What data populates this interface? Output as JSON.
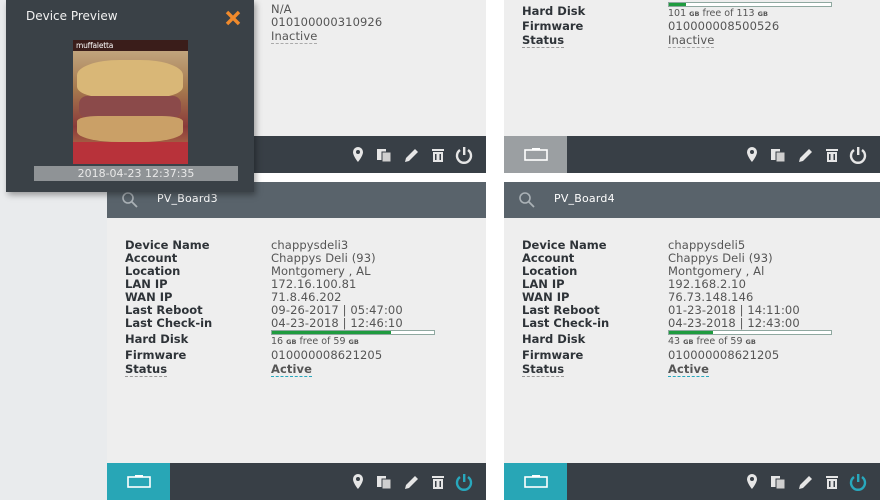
{
  "preview": {
    "title": "Device Preview",
    "image_brand": "muffaletta",
    "timestamp": "2018-04-23 12:37:35"
  },
  "labels": {
    "device_name": "Device Name",
    "account": "Account",
    "location": "Location",
    "lan_ip": "LAN IP",
    "wan_ip": "WAN IP",
    "last_reboot": "Last Reboot",
    "last_checkin": "Last Check-in",
    "hard_disk": "Hard Disk",
    "firmware": "Firmware",
    "status": "Status"
  },
  "disk_unit": "GB",
  "cards": {
    "top_left": {
      "rows_visible": {
        "line1": "N/A",
        "firmware": "010100000310926",
        "status": "Inactive"
      }
    },
    "top_right": {
      "hard_disk": {
        "free": "101",
        "total": "113",
        "used_fraction": 0.11
      },
      "firmware": "010000008500526",
      "status": "Inactive"
    },
    "board3": {
      "board": "PV_Board3",
      "device_name": "chappysdeli3",
      "account": "Chappys Deli (93)",
      "location": "Montgomery , AL",
      "lan_ip": "172.16.100.81",
      "wan_ip": "71.8.46.202",
      "last_reboot": "09-26-2017 | 05:47:00",
      "last_checkin": "04-23-2018 | 12:46:10",
      "hard_disk": {
        "free": "16",
        "total": "59",
        "used_fraction": 0.73
      },
      "firmware": "010000008621205",
      "status": "Active"
    },
    "board4": {
      "board": "PV_Board4",
      "device_name": "chappysdeli5",
      "account": "Chappys Deli (93)",
      "location": "Montgomery , Al",
      "lan_ip": "192.168.2.10",
      "wan_ip": "76.73.148.146",
      "last_reboot": "01-23-2018 | 14:11:00",
      "last_checkin": "04-23-2018 | 12:43:00",
      "hard_disk": {
        "free": "43",
        "total": "59",
        "used_fraction": 0.27
      },
      "firmware": "010000008621205",
      "status": "Active"
    }
  },
  "disk_text": {
    "free_of": "free of"
  },
  "colors": {
    "active": "#28a8bd",
    "disk_fill": "#1f9b3f",
    "header": "#59636b",
    "footer": "#383f46",
    "close_x": "#f08a2c"
  },
  "icons": [
    "search-icon",
    "location-pin-icon",
    "copy-icon",
    "edit-pencil-icon",
    "trash-icon",
    "power-icon",
    "screen-icon",
    "close-icon"
  ]
}
